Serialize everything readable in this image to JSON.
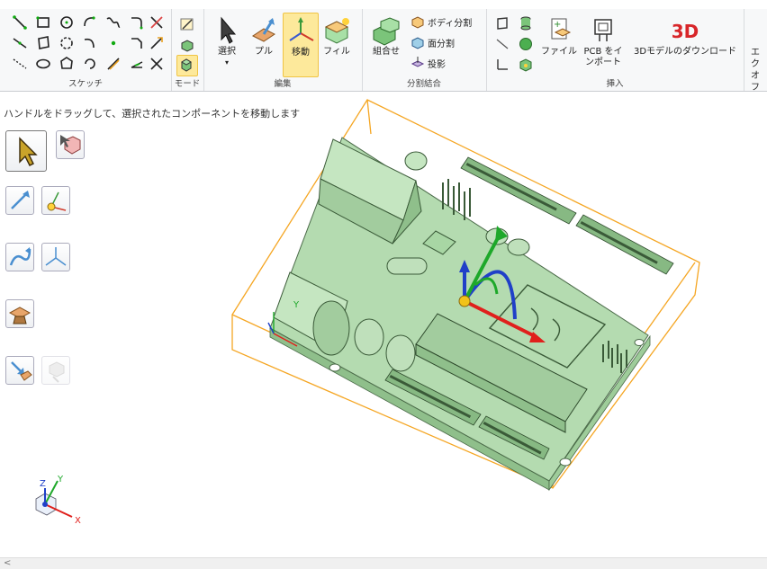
{
  "ribbon": {
    "groups": {
      "sketch": {
        "label": "スケッチ"
      },
      "mode": {
        "label": "モード"
      },
      "edit": {
        "label": "編集",
        "buttons": {
          "select": "選択",
          "pull": "プル",
          "move": "移動",
          "fill": "フィル"
        }
      },
      "split": {
        "label": "分割結合",
        "combine": "組合せ",
        "body_split": "ボディ分割",
        "face_split": "面分割",
        "project": "投影"
      },
      "insert": {
        "label": "挿入",
        "file": "ファイル",
        "pcb_line1": "PCB をイ",
        "pcb_line2": "ンポート",
        "download_3d": "3Dモデルのダウンロード",
        "badge_3d": "3D"
      },
      "extra": {
        "line1": "エク",
        "line2": "オフ"
      }
    }
  },
  "status_text": "ハンドルをドラッグして、選択されたコンポーネントを移動します",
  "triad": {
    "x": "X",
    "y": "Y",
    "z": "Z"
  },
  "board": {
    "axis_label": "Y"
  },
  "scrollbar": {
    "left_arrow": "<"
  },
  "colors": {
    "accent": "#f0c444",
    "board": "#b4dbb0",
    "bbox": "#f5a623",
    "axis_x": "#e0201c",
    "axis_y": "#1ea82a",
    "axis_z": "#2040c8"
  }
}
